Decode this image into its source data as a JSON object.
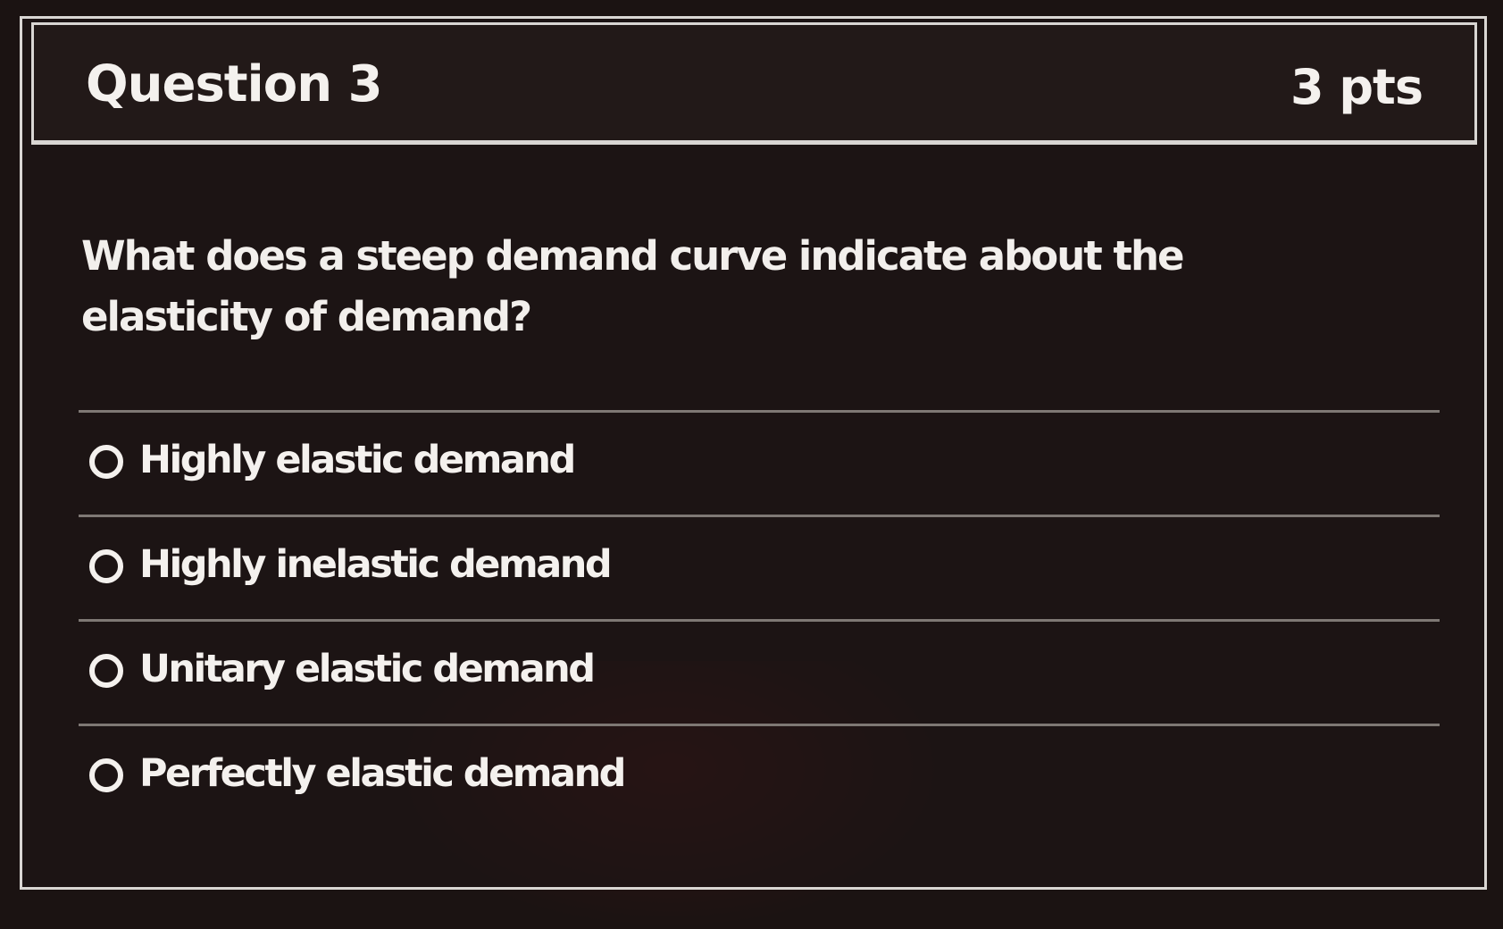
{
  "question": {
    "title": "Question 3",
    "points": "3 pts",
    "text": "What does a steep demand curve indicate about the elasticity of demand?"
  },
  "answers": [
    {
      "label": "Highly elastic demand",
      "selected": false
    },
    {
      "label": "Highly inelastic demand",
      "selected": false
    },
    {
      "label": "Unitary elastic demand",
      "selected": false
    },
    {
      "label": "Perfectly elastic demand",
      "selected": false
    }
  ],
  "colors": {
    "background": "#1b1312",
    "border": "#d9d6d3",
    "text": "#f4f1ee",
    "divider": "#7e7874"
  },
  "icons": {
    "radio": "radio-unchecked-icon"
  }
}
